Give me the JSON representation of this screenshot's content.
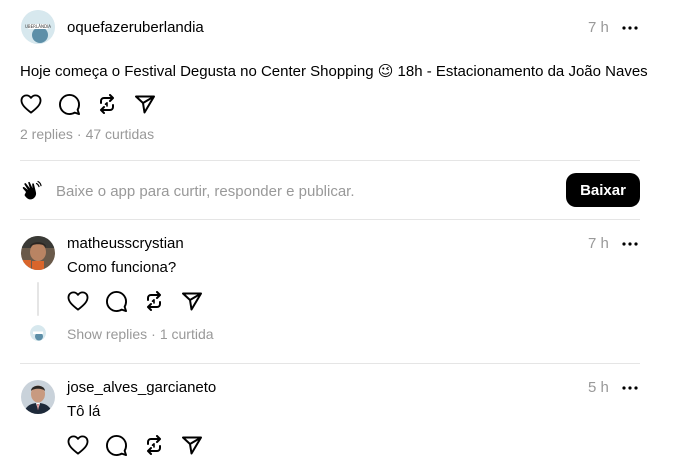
{
  "post": {
    "username": "oquefazeruberlandia",
    "time": "7 h",
    "text": "Hoje começa o Festival Degusta no Center Shopping 😉 18h - Estacionamento da João Naves",
    "replies": "2 replies",
    "likes": "47 curtidas",
    "separator": "·"
  },
  "prompt": {
    "text": "Baixe o app para curtir, responder e publicar.",
    "button_label": "Baixar"
  },
  "replies": [
    {
      "username": "matheusscrystian",
      "time": "7 h",
      "text": "Como funciona?",
      "show_replies": "Show replies",
      "likes": "1 curtida",
      "separator": "·"
    },
    {
      "username": "jose_alves_garcianeto",
      "time": "5 h",
      "text": "Tô lá"
    }
  ],
  "icons": [
    "heart-icon",
    "comment-icon",
    "repost-icon",
    "share-icon",
    "more-icon",
    "hand-icon"
  ],
  "colors": {
    "primary_text": "#000000",
    "secondary_text": "#999999",
    "divider": "#e5e5e5",
    "button_bg": "#000000",
    "button_text": "#ffffff"
  }
}
